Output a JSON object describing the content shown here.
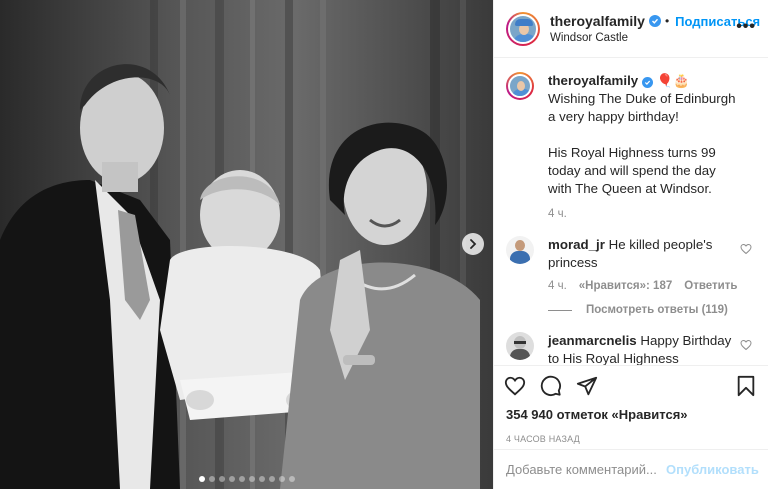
{
  "post": {
    "username": "theroyalfamily",
    "follow_label": "Подписаться",
    "location": "Windsor Castle",
    "more_label": "•••",
    "carousel_count": 10,
    "carousel_active": 0
  },
  "caption": {
    "username": "theroyalfamily",
    "emoji": "🎈🎂",
    "text_1": "Wishing The Duke of Edinburgh a very happy birthday!",
    "text_2": "His Royal Highness turns 99 today and will spend the day with The Queen at Windsor.",
    "time": "4 ч."
  },
  "comments": [
    {
      "username": "morad_jr",
      "text": "He killed people's princess",
      "time": "4 ч.",
      "likes": "«Нравится»: 187",
      "reply_label": "Ответить",
      "view_replies": "Посмотреть ответы (119)"
    },
    {
      "username": "jeanmarcnelis",
      "text": "Happy Birthday to His Royal Highness"
    }
  ],
  "stats": {
    "likes": "354 940 отметок «Нравится»",
    "posted_ago": "4 ЧАСОВ НАЗАД"
  },
  "add_comment": {
    "placeholder": "Добавьте комментарий...",
    "publish_label": "Опубликовать"
  },
  "icons": [
    "heart-icon",
    "comment-icon",
    "share-icon",
    "bookmark-icon",
    "verified-icon",
    "chevron-right-icon"
  ],
  "colors": {
    "accent": "#0095f6",
    "verified": "#3897f0",
    "muted": "#8e8e8e",
    "publish_disabled": "#b2dffc"
  }
}
